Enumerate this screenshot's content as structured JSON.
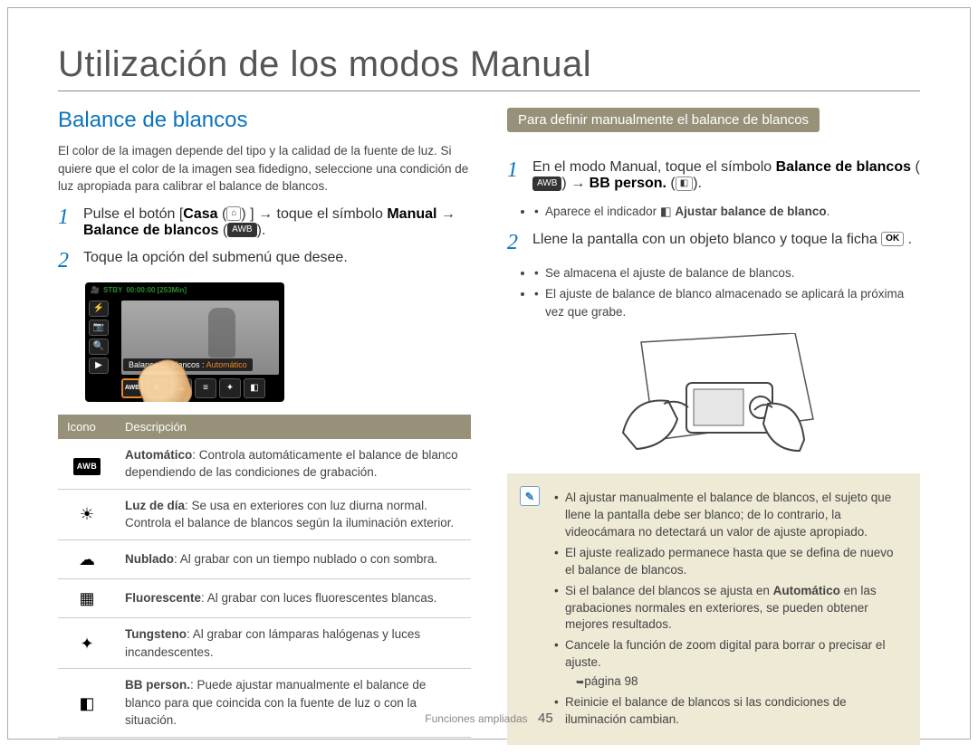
{
  "page_title": "Utilización de los modos Manual",
  "section_left_title": "Balance de blancos",
  "intro_paragraph": "El color de la imagen depende del tipo y la calidad de la fuente de luz. Si quiere que el color de la imagen sea fidedigno, seleccione una condición de luz apropiada para calibrar el balance de blancos.",
  "left_step1_prefix": "Pulse el botón [",
  "left_step1_casa": "Casa",
  "left_step1_mid1": "] → toque el símbolo ",
  "left_step1_manual": "Manual",
  "left_step1_mid2": " → ",
  "left_step1_bb": "Balance de blancos",
  "left_step1_suffix": " (",
  "left_step1_end": ").",
  "left_step2": "Toque la opción del submenú que desee.",
  "lcd_stby": "STBY",
  "lcd_time": "00:00:00 [253Min]",
  "lcd_label_prefix": "Balance de blancos : ",
  "lcd_label_value": "Automático",
  "lcd_awb": "AWB",
  "table_header_icon": "Icono",
  "table_header_desc": "Descripción",
  "rows": [
    {
      "name": "Automático",
      "text": ": Controla automáticamente el balance de blanco dependiendo de las condiciones de grabación."
    },
    {
      "name": "Luz de día",
      "text": ": Se usa en exteriores con luz diurna normal. Controla el balance de blancos según la iluminación exterior."
    },
    {
      "name": "Nublado",
      "text": ": Al grabar con un tiempo nublado o con sombra."
    },
    {
      "name": "Fluorescente",
      "text": ": Al grabar con luces fluorescentes blancas."
    },
    {
      "name": "Tungsteno",
      "text": ": Al grabar con lámparas halógenas y luces incandescentes."
    },
    {
      "name": "BB person.",
      "text": ": Puede ajustar manualmente el balance de blanco para que coincida con la fuente de luz o con la situación."
    }
  ],
  "right_pill": "Para definir manualmente el balance de blancos",
  "right_step1_a": "En el modo Manual, toque el símbolo ",
  "right_step1_bb": "Balance de blancos",
  "right_step1_b": " (",
  "right_step1_c": ") → ",
  "right_step1_bbp": "BB person.",
  "right_step1_d": " (",
  "right_step1_e": ").",
  "right_sub1_prefix": "Aparece el indicador ",
  "right_sub1_bold": "Ajustar balance de blanco",
  "right_sub1_suffix": ".",
  "right_step2_a": "Llene la pantalla con un objeto blanco y toque la ficha ",
  "right_step2_ok": "OK",
  "right_step2_b": " .",
  "right_sub2a": "Se almacena el ajuste de balance de blancos.",
  "right_sub2b": "El ajuste de balance de blanco almacenado se aplicará la próxima vez que grabe.",
  "note1": "Al ajustar manualmente el balance de blancos, el sujeto que llene la pantalla debe ser blanco; de lo contrario, la videocámara no detectará un valor de ajuste apropiado.",
  "note2": "El ajuste realizado permanece hasta que se defina de nuevo el balance de blancos.",
  "note3_a": "Si el balance del blancos se ajusta en ",
  "note3_auto": "Automático",
  "note3_b": " en las grabaciones normales en exteriores, se pueden obtener mejores resultados.",
  "note4": "Cancele la función de zoom digital para borrar o precisar el ajuste.",
  "note4_ref": "página 98",
  "note5": "Reinicie el balance de blancos si las condiciones de iluminación cambian.",
  "footer_label": "Funciones ampliadas",
  "footer_page": "45"
}
